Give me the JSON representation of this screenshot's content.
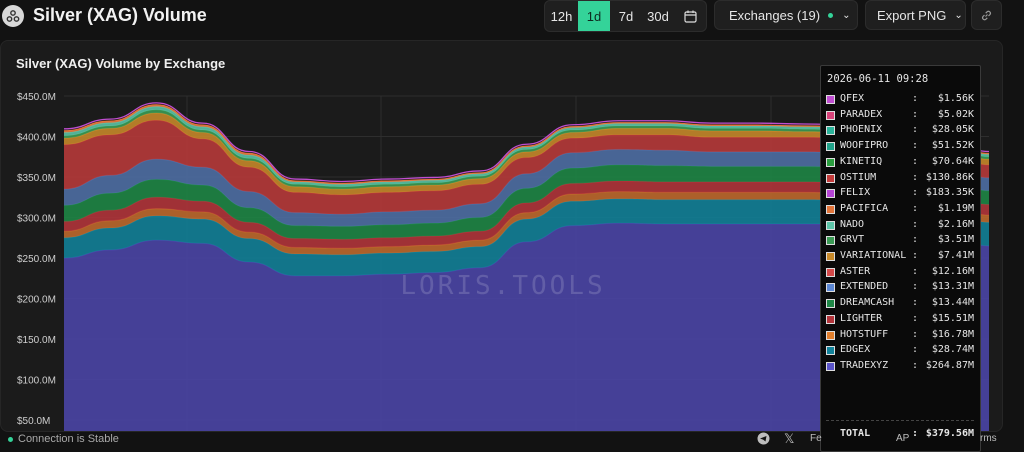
{
  "header": {
    "title": "Silver (XAG) Volume",
    "timeframes": [
      "12h",
      "1d",
      "7d",
      "30d"
    ],
    "active_timeframe": "1d",
    "exchanges_label": "Exchanges (19)",
    "export_label": "Export PNG"
  },
  "panel": {
    "title": "Silver (XAG) Volume by Exchange",
    "watermark": "LORIS.TOOLS"
  },
  "chart_data": {
    "type": "area",
    "title": "Silver (XAG) Volume by Exchange",
    "y_ticks": [
      "$50.0M",
      "$100.0M",
      "$150.0M",
      "$200.0M",
      "$250.0M",
      "$300.0M",
      "$350.0M",
      "$400.0M",
      "$450.0M"
    ],
    "ylim": [
      0,
      450
    ],
    "grid": true,
    "x": [
      0,
      1,
      2,
      3,
      4,
      5,
      6,
      7,
      8,
      9,
      10,
      11,
      12,
      13,
      14,
      15,
      16,
      17,
      18,
      19,
      20
    ],
    "totals_million": [
      408,
      420,
      440,
      415,
      380,
      345,
      340,
      345,
      348,
      355,
      390,
      410,
      418,
      418,
      413,
      413,
      412,
      410,
      408,
      395,
      382
    ],
    "stack_order_bottom_to_top": [
      "TRADEXYZ",
      "EDGEX",
      "HOTSTUFF",
      "LIGHTER",
      "DREAMCASH",
      "EXTENDED",
      "ASTER",
      "VARIATIONAL",
      "GRVT",
      "NADO",
      "PACIFICA"
    ],
    "series": [
      {
        "name": "TRADEXYZ",
        "color": "#4b45a8",
        "values": [
          250,
          260,
          272,
          268,
          245,
          228,
          228,
          230,
          232,
          238,
          270,
          290,
          293,
          292,
          292,
          292,
          292,
          292,
          292,
          280,
          265
        ]
      },
      {
        "name": "EDGEX",
        "color": "#11829a",
        "values": [
          25,
          27,
          30,
          30,
          29,
          27,
          26,
          26,
          26,
          26,
          28,
          30,
          30,
          30,
          30,
          30,
          30,
          29,
          29,
          29,
          29
        ]
      },
      {
        "name": "HOTSTUFF",
        "color": "#c06a2c",
        "values": [
          8,
          9,
          9,
          9,
          8,
          8,
          8,
          8,
          8,
          8,
          8,
          9,
          9,
          9,
          9,
          9,
          9,
          9,
          9,
          9,
          9
        ]
      },
      {
        "name": "LIGHTER",
        "color": "#b3343a",
        "values": [
          12,
          13,
          14,
          13,
          12,
          11,
          11,
          11,
          11,
          11,
          12,
          13,
          13,
          13,
          13,
          13,
          13,
          13,
          13,
          13,
          13
        ]
      },
      {
        "name": "DREAMCASH",
        "color": "#1e8746",
        "values": [
          20,
          21,
          22,
          20,
          18,
          16,
          16,
          16,
          16,
          17,
          18,
          19,
          20,
          20,
          19,
          19,
          19,
          19,
          19,
          18,
          17
        ]
      },
      {
        "name": "EXTENDED",
        "color": "#4f6fa6",
        "values": [
          20,
          22,
          25,
          22,
          20,
          16,
          15,
          16,
          16,
          17,
          18,
          19,
          19,
          19,
          18,
          18,
          18,
          18,
          17,
          16,
          16
        ]
      },
      {
        "name": "ASTER",
        "color": "#b93a3a",
        "values": [
          55,
          50,
          48,
          35,
          30,
          25,
          24,
          24,
          24,
          24,
          20,
          18,
          18,
          19,
          18,
          18,
          18,
          18,
          18,
          17,
          16
        ]
      },
      {
        "name": "VARIATIONAL",
        "color": "#c88a2a",
        "values": [
          8,
          8,
          9,
          8,
          8,
          7,
          7,
          7,
          7,
          7,
          7,
          7,
          8,
          8,
          8,
          8,
          7,
          7,
          7,
          7,
          7
        ]
      },
      {
        "name": "GRVT",
        "color": "#3b9b55",
        "values": [
          3,
          3,
          4,
          3,
          3,
          3,
          3,
          3,
          3,
          3,
          3,
          3,
          3,
          3,
          3,
          3,
          3,
          3,
          3,
          3,
          3
        ]
      },
      {
        "name": "NADO",
        "color": "#5cc4a8",
        "values": [
          4,
          4,
          4,
          4,
          4,
          3,
          3,
          3,
          3,
          3,
          3,
          3,
          3,
          3,
          3,
          3,
          3,
          3,
          3,
          3,
          3
        ]
      },
      {
        "name": "PACIFICA",
        "color": "#e3743a",
        "values": [
          2,
          2,
          2,
          2,
          2,
          1,
          1,
          1,
          1,
          1,
          1,
          1,
          1,
          1,
          1,
          1,
          1,
          1,
          1,
          1,
          1
        ]
      }
    ]
  },
  "tooltip": {
    "date": "2026-06-11 09:28",
    "rows": [
      {
        "name": "QFEX",
        "value": "$1.56K",
        "color": "#c04ed1"
      },
      {
        "name": "PARADEX",
        "value": "$5.02K",
        "color": "#d8437a"
      },
      {
        "name": "PHOENIX",
        "value": "$28.05K",
        "color": "#2ab39a"
      },
      {
        "name": "WOOFIPRO",
        "value": "$51.52K",
        "color": "#20a28a"
      },
      {
        "name": "KINETIQ",
        "value": "$70.64K",
        "color": "#2a9e3f"
      },
      {
        "name": "OSTIUM",
        "value": "$130.86K",
        "color": "#c33a3a"
      },
      {
        "name": "FELIX",
        "value": "$183.35K",
        "color": "#b545d6"
      },
      {
        "name": "PACIFICA",
        "value": "$1.19M",
        "color": "#e3743a"
      },
      {
        "name": "NADO",
        "value": "$2.16M",
        "color": "#5cc4a8"
      },
      {
        "name": "GRVT",
        "value": "$3.51M",
        "color": "#3b9b55"
      },
      {
        "name": "VARIATIONAL",
        "value": "$7.41M",
        "color": "#c88a2a"
      },
      {
        "name": "ASTER",
        "value": "$12.16M",
        "color": "#d44a4a"
      },
      {
        "name": "EXTENDED",
        "value": "$13.31M",
        "color": "#5b87d4"
      },
      {
        "name": "DREAMCASH",
        "value": "$13.44M",
        "color": "#1e8746"
      },
      {
        "name": "LIGHTER",
        "value": "$15.51M",
        "color": "#b3343a"
      },
      {
        "name": "HOTSTUFF",
        "value": "$16.78M",
        "color": "#e07e2c"
      },
      {
        "name": "EDGEX",
        "value": "$28.74M",
        "color": "#11829a"
      },
      {
        "name": "TRADEXYZ",
        "value": "$264.87M",
        "color": "#5a54c9"
      }
    ],
    "total_label": "TOTAL",
    "total_value": "$379.56M"
  },
  "status": {
    "connection": "Connection is Stable",
    "footer_right": "rms",
    "footer_mid": "Fe",
    "footer_api": "AP"
  },
  "colors": {
    "accent": "#34d399",
    "background": "#121212",
    "panel": "#1b1b1b"
  }
}
